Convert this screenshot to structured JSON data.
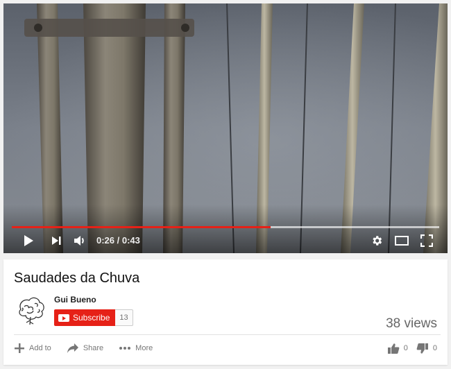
{
  "player": {
    "current_time": "0:26",
    "duration": "0:43",
    "time_display": "0:26 / 0:43",
    "played_fraction": 0.605,
    "loaded_fraction": 1.0,
    "accent_color": "#e62117"
  },
  "video": {
    "title": "Saudades da Chuva",
    "views": "38 views"
  },
  "channel": {
    "name": "Gui Bueno",
    "subscribe_label": "Subscribe",
    "subscriber_count": "13"
  },
  "actions": {
    "add_to": "Add to",
    "share": "Share",
    "more": "More"
  },
  "rating": {
    "likes": "0",
    "dislikes": "0"
  },
  "icons": {
    "play": "play-icon",
    "next": "next-icon",
    "volume": "volume-icon",
    "settings": "gear-icon",
    "theater": "theater-mode-icon",
    "fullscreen": "fullscreen-icon",
    "add": "plus-icon",
    "share": "share-arrow-icon",
    "more": "more-dots-icon",
    "like": "thumbs-up-icon",
    "dislike": "thumbs-down-icon"
  }
}
